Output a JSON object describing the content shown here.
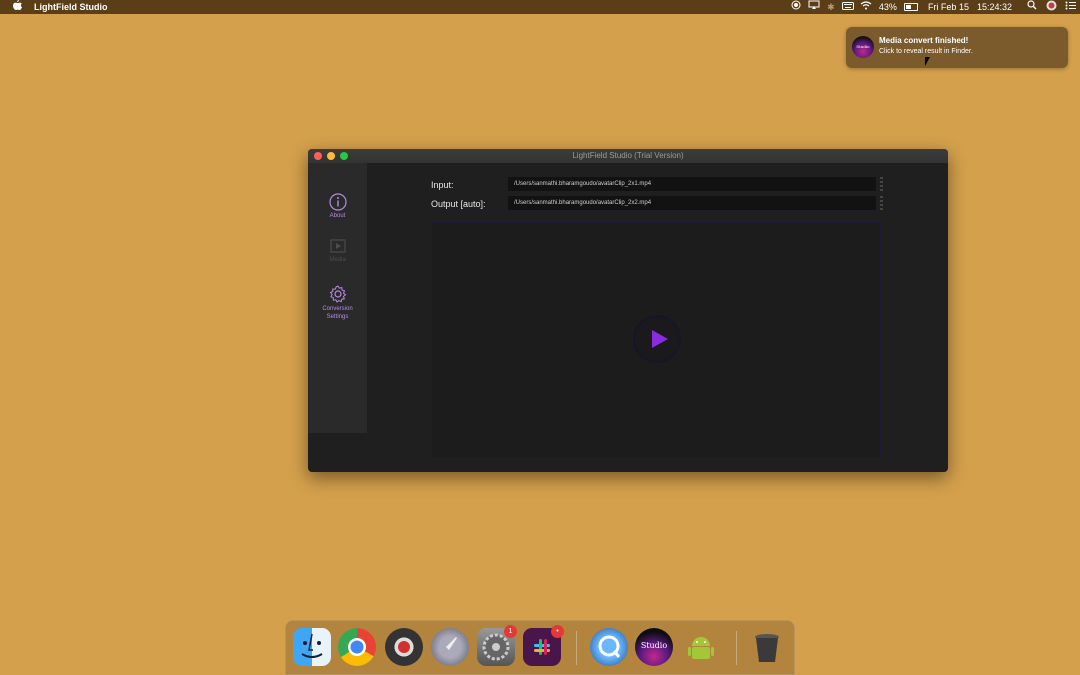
{
  "menubar": {
    "app_name": "LightField Studio",
    "battery": "43%",
    "date": "Fri Feb 15",
    "time": "15:24:32"
  },
  "notification": {
    "title": "Media convert finished!",
    "body": "Click to reveal result in Finder.",
    "icon_text": "Studio"
  },
  "window": {
    "title": "LightField Studio (Trial Version)"
  },
  "sidebar": {
    "items": [
      {
        "label": "About"
      },
      {
        "label": "Media"
      },
      {
        "label": "Conversion Settings"
      }
    ]
  },
  "form": {
    "input_label": "Input:",
    "input_value": "/Users/sanmathi.bharamgoudo/avatarClip_2x1.mp4",
    "output_label": "Output [auto]:",
    "output_value": "/Users/sanmathi.bharamgoudo/avatarClip_2x2.mp4"
  },
  "dock": {
    "items": [
      {
        "name": "Finder"
      },
      {
        "name": "Chrome"
      },
      {
        "name": "Screen Recorder"
      },
      {
        "name": "Launchpad"
      },
      {
        "name": "System Preferences",
        "badge": "1"
      },
      {
        "name": "Slack",
        "badge": "•"
      },
      {
        "name": "QuickTime"
      },
      {
        "name": "LightField Studio",
        "label": "Studio"
      },
      {
        "name": "Android"
      },
      {
        "name": "Trash"
      }
    ]
  },
  "colors": {
    "desktop": "#d4a04c",
    "accent": "#8a2be2",
    "sidebar_icon": "#b78be0"
  }
}
